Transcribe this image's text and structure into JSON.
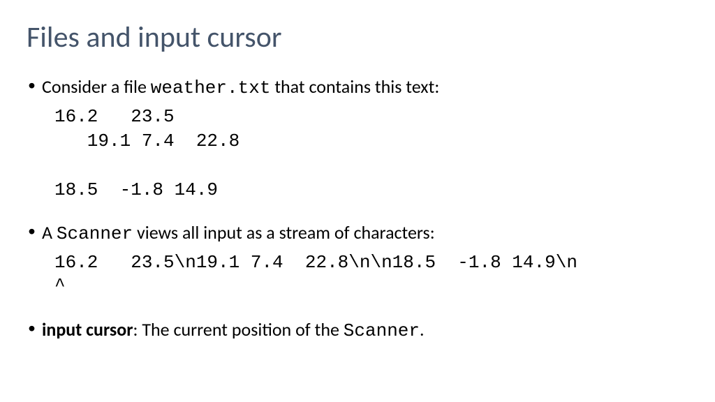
{
  "title": "Files and input cursor",
  "bullets": {
    "b1_pre": "Consider a file ",
    "b1_mono": "weather.txt",
    "b1_post": " that contains this text:",
    "file_content": "16.2   23.5\n   19.1 7.4  22.8\n\n18.5  -1.8 14.9",
    "b2_pre": "A ",
    "b2_mono": "Scanner",
    "b2_post": " views all input as a stream of characters:",
    "stream": "16.2   23.5\\n19.1 7.4  22.8\\n\\n18.5  -1.8 14.9\\n\n^",
    "b3_bold": "input cursor",
    "b3_mid": ": The current position of the ",
    "b3_mono": "Scanner",
    "b3_post": "."
  }
}
